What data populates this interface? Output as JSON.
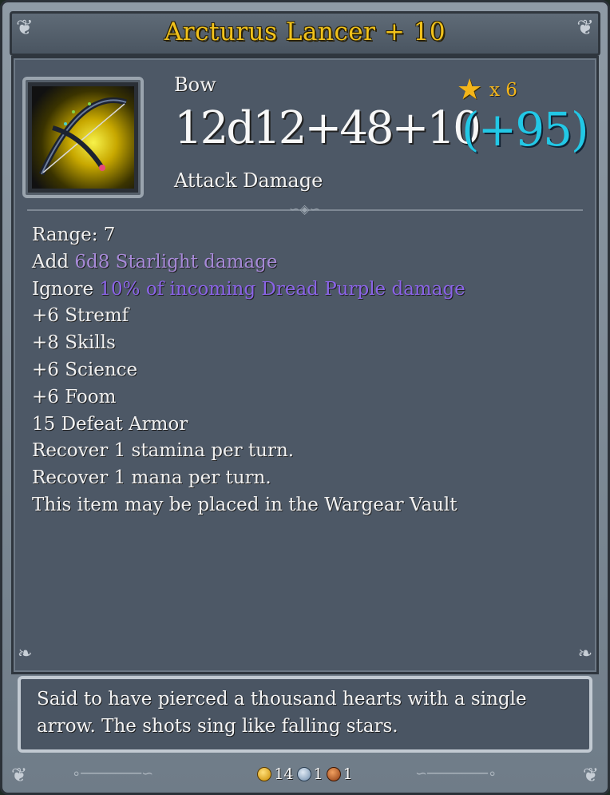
{
  "title": "Arcturus Lancer + 10",
  "item": {
    "type": "Bow",
    "damage": "12d12+48+10",
    "bonus": "(+95)",
    "damage_label": "Attack Damage",
    "stars_count": "x 6",
    "icon": "bow-icon"
  },
  "stats": {
    "range": "Range: 7",
    "add_prefix": "Add ",
    "add_value": "6d8 Starlight damage",
    "ignore_prefix": "Ignore ",
    "ignore_value": "10% of incoming Dread Purple damage",
    "stremf": "+6 Stremf",
    "skills": "+8 Skills",
    "science": "+6 Science",
    "foom": "+6 Foom",
    "defeat_armor": "15 Defeat Armor",
    "stamina": "Recover 1 stamina per turn.",
    "mana": "Recover 1 mana per turn.",
    "vault": "This item may be placed in the Wargear Vault"
  },
  "lore": "Said to have pierced a thousand hearts with a single arrow. The shots sing like falling stars.",
  "currency": {
    "gold": "14",
    "silver": "1",
    "copper": "1"
  },
  "colors": {
    "title": "#f1c21b",
    "bonus": "#22c8e6",
    "attribute": "#35c8e3",
    "starlight": "#a78ad8",
    "dread_purple": "#8b64e8",
    "vault_note": "#e7b62c",
    "star": "#f3b51a"
  }
}
